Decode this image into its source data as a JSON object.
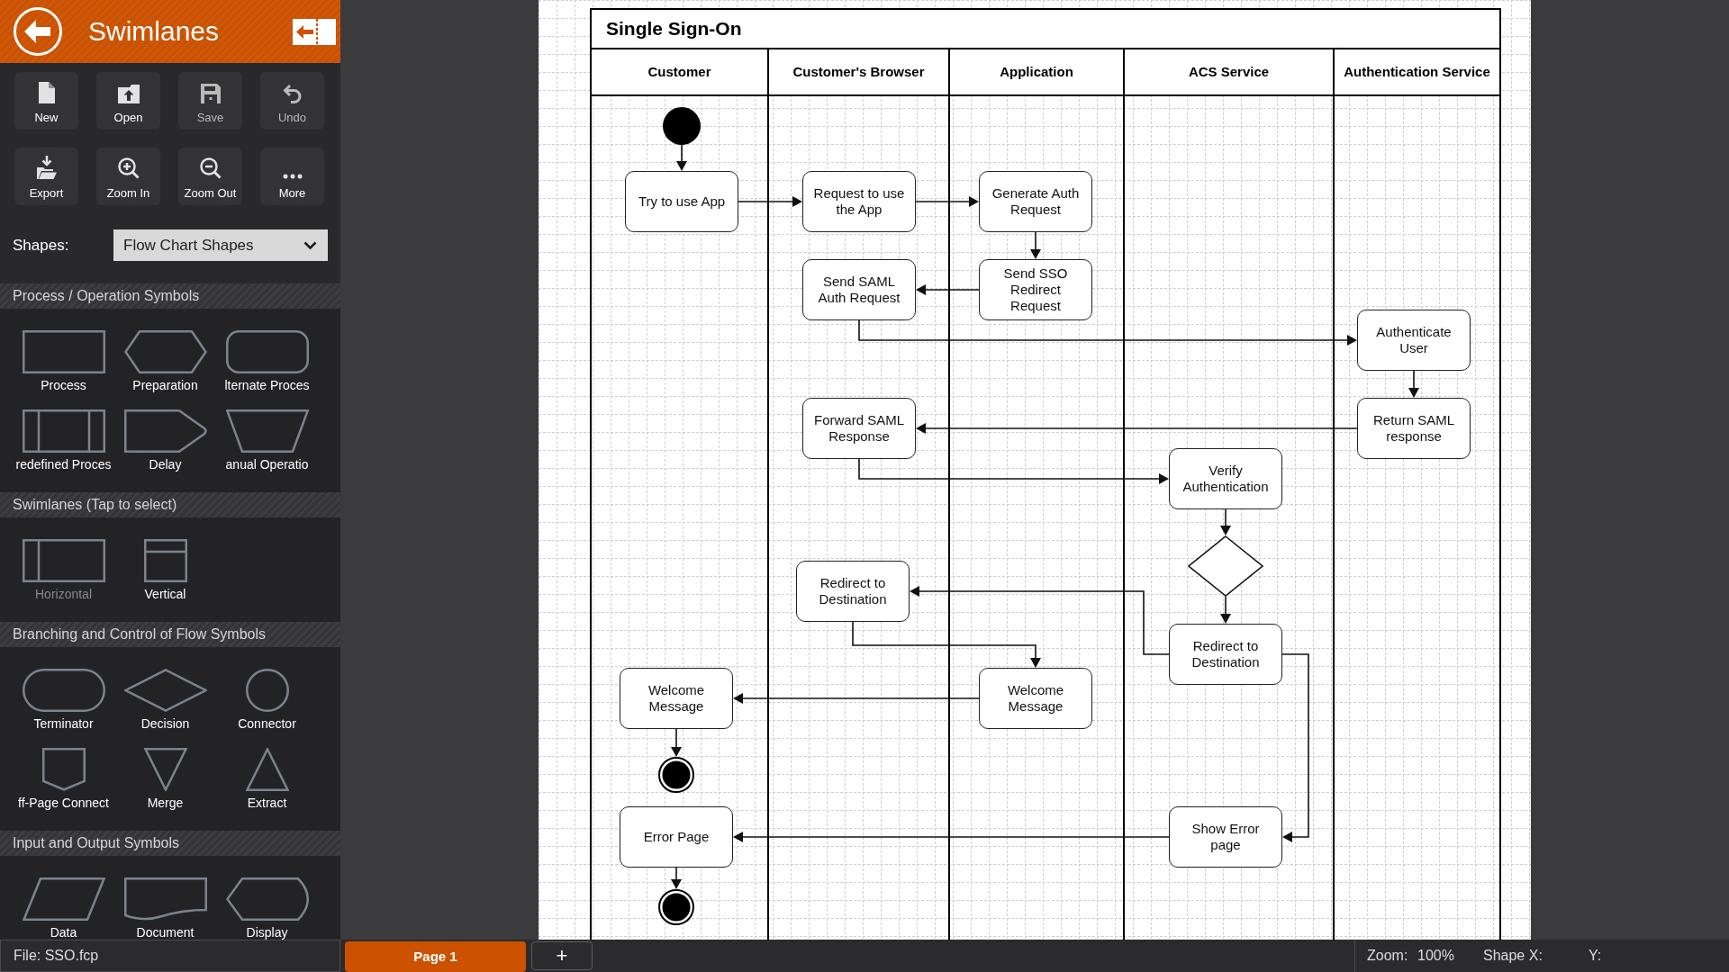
{
  "header": {
    "title": "Swimlanes"
  },
  "toolbar": [
    {
      "label": "New",
      "disabled": false
    },
    {
      "label": "Open",
      "disabled": false
    },
    {
      "label": "Save",
      "disabled": true
    },
    {
      "label": "Undo",
      "disabled": true
    },
    {
      "label": "Export",
      "disabled": false
    },
    {
      "label": "Zoom In",
      "disabled": false
    },
    {
      "label": "Zoom Out",
      "disabled": false
    },
    {
      "label": "More",
      "disabled": false
    }
  ],
  "shapes_picker": {
    "label": "Shapes:",
    "value": "Flow Chart Shapes"
  },
  "sections": [
    {
      "title": "Process / Operation Symbols",
      "items": [
        {
          "label": "Process"
        },
        {
          "label": "Preparation"
        },
        {
          "label": "lternate Proces"
        },
        {
          "label": "redefined Proces"
        },
        {
          "label": "Delay"
        },
        {
          "label": "anual Operatio"
        }
      ]
    },
    {
      "title": "Swimlanes (Tap to select)",
      "items": [
        {
          "label": "Horizontal",
          "selected": false
        },
        {
          "label": "Vertical",
          "selected": true
        }
      ]
    },
    {
      "title": "Branching and Control of Flow Symbols",
      "items": [
        {
          "label": "Terminator"
        },
        {
          "label": "Decision"
        },
        {
          "label": "Connector"
        },
        {
          "label": "ff-Page Connect"
        },
        {
          "label": "Merge"
        },
        {
          "label": "Extract"
        }
      ]
    },
    {
      "title": "Input and Output Symbols",
      "items": [
        {
          "label": "Data"
        },
        {
          "label": "Document"
        },
        {
          "label": "Display"
        }
      ]
    }
  ],
  "diagram": {
    "title": "Single Sign-On",
    "lanes": [
      "Customer",
      "Customer's Browser",
      "Application",
      "ACS Service",
      "Authentication Service"
    ],
    "nodes": [
      {
        "kind": "start"
      },
      {
        "kind": "action",
        "text": "Try to use App"
      },
      {
        "kind": "action",
        "text": "Request to use the App"
      },
      {
        "kind": "action",
        "text": "Generate Auth Request"
      },
      {
        "kind": "action",
        "text": "Send SAML Auth Request"
      },
      {
        "kind": "action",
        "text": "Send SSO Redirect Request"
      },
      {
        "kind": "action",
        "text": "Authenticate User"
      },
      {
        "kind": "action",
        "text": "Forward SAML Response"
      },
      {
        "kind": "action",
        "text": "Return SAML response"
      },
      {
        "kind": "action",
        "text": "Verify Authentication"
      },
      {
        "kind": "decision"
      },
      {
        "kind": "action",
        "text": "Redirect to Destination"
      },
      {
        "kind": "action",
        "text": "Redirect to Destination"
      },
      {
        "kind": "action",
        "text": "Welcome Message"
      },
      {
        "kind": "action",
        "text": "Welcome Message"
      },
      {
        "kind": "end"
      },
      {
        "kind": "action",
        "text": "Error Page"
      },
      {
        "kind": "action",
        "text": "Show Error page"
      },
      {
        "kind": "end"
      }
    ]
  },
  "status_bar": {
    "file": "File: SSO.fcp",
    "pages": [
      {
        "label": "Page 1",
        "selected": true
      }
    ],
    "add_page": "+",
    "zoom_label": "Zoom:",
    "zoom": "100%",
    "shape_x_label": "Shape X:",
    "shape_y_label": "Y:"
  }
}
